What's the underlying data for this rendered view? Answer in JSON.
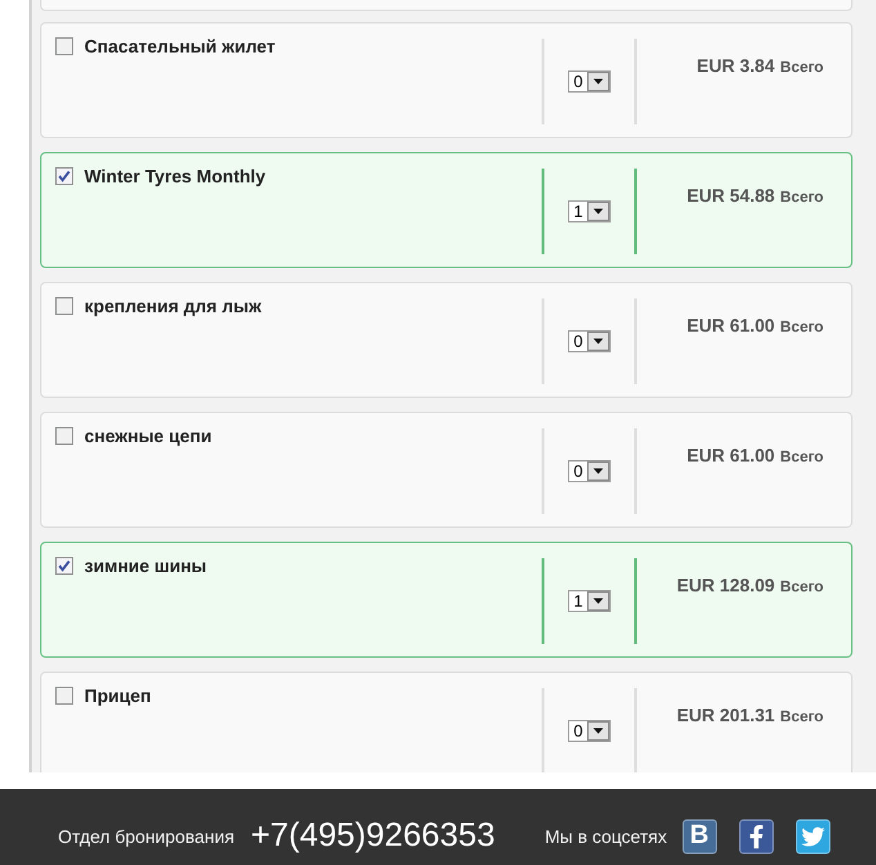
{
  "items": [
    {
      "name": "Спасательный жилет",
      "checked": false,
      "quantity": "0",
      "price": "EUR 3.84",
      "total_label": "Всего"
    },
    {
      "name": "Winter Tyres Monthly",
      "checked": true,
      "quantity": "1",
      "price": "EUR 54.88",
      "total_label": "Всего"
    },
    {
      "name": "крепления для лыж",
      "checked": false,
      "quantity": "0",
      "price": "EUR 61.00",
      "total_label": "Всего"
    },
    {
      "name": "снежные цепи",
      "checked": false,
      "quantity": "0",
      "price": "EUR 61.00",
      "total_label": "Всего"
    },
    {
      "name": "зимние шины",
      "checked": true,
      "quantity": "1",
      "price": "EUR 128.09",
      "total_label": "Всего"
    },
    {
      "name": "Прицеп",
      "checked": false,
      "quantity": "0",
      "price": "EUR 201.31",
      "total_label": "Всего"
    }
  ],
  "footer": {
    "booking_label": "Отдел бронирования",
    "phone": "+7(495)9266353",
    "social_label": "Мы в соцсетях",
    "social_links": [
      {
        "kind": "vk",
        "glyph": "В"
      },
      {
        "kind": "facebook"
      },
      {
        "kind": "twitter"
      }
    ]
  }
}
